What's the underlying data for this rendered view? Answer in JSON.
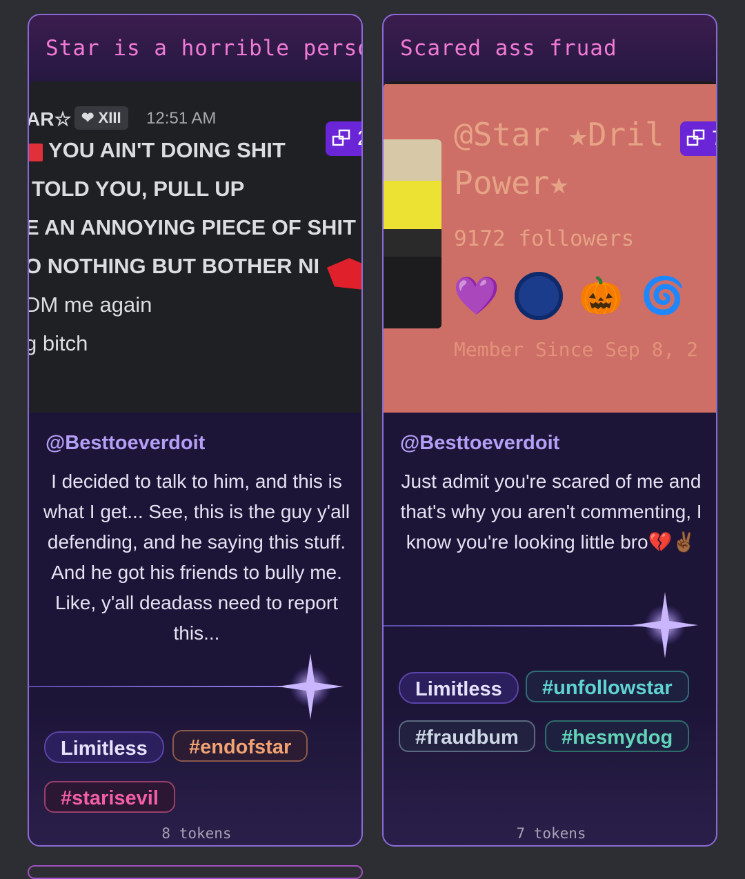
{
  "cards": [
    {
      "title": "Star is a horrible person.",
      "image_count": "2",
      "screenshot": {
        "user": "AR☆",
        "tag": "❤ XIII",
        "time": "12:51 AM",
        "lines": [
          "YOU AIN'T DOING SHIT",
          "TOLD YOU, PULL UP",
          "E AN ANNOYING PIECE OF SHIT",
          "O NOTHING BUT BOTHER NI",
          "DM me again",
          "g bitch"
        ]
      },
      "author": "@Besttoeverdoit",
      "caption": "I decided to talk to him, and this is what I get... See, this is the guy y'all defending, and he saying this stuff. And he got his friends to bully me. Like, y'all deadass need to report this...",
      "tags": [
        {
          "label": "Limitless"
        },
        {
          "label": "#endofstar"
        },
        {
          "label": "#starisevil"
        }
      ],
      "tokens": "8 tokens"
    },
    {
      "title": "Scared ass fruad",
      "image_count": "7",
      "screenshot": {
        "handle_line1": "@Star ★Dril",
        "handle_line2": "Power★",
        "followers": "9172 followers",
        "badges": [
          "💜",
          "🔵",
          "🎃",
          "🌀"
        ],
        "member_since": "Member Since Sep 8, 2"
      },
      "author": "@Besttoeverdoit",
      "caption": "Just admit you're scared of me and that's why you aren't commenting, I know you're looking little bro💔✌🏾",
      "tags": [
        {
          "label": "Limitless"
        },
        {
          "label": "#unfollowstar"
        },
        {
          "label": "#fraudbum"
        },
        {
          "label": "#hesmydog"
        }
      ],
      "tokens": "7 tokens"
    }
  ]
}
